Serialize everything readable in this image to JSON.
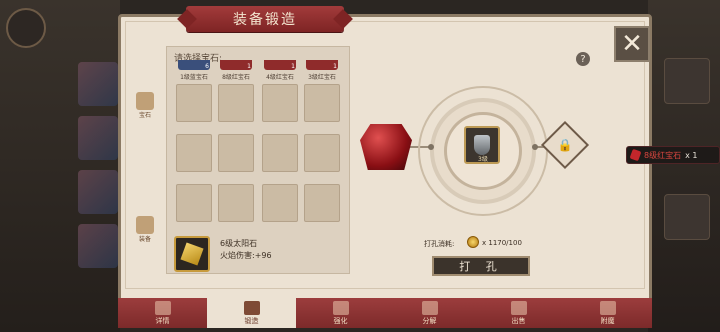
{
  "title": "装备锻造",
  "close_label": "✕",
  "help_label": "?",
  "side_tabs": [
    {
      "label": "宝石"
    },
    {
      "label": "装备"
    }
  ],
  "gem_picker": {
    "label": "请选择宝石:",
    "top_gems": [
      {
        "name": "1级蓝宝石",
        "count": "6"
      },
      {
        "name": "8级红宝石",
        "count": "1"
      },
      {
        "name": "4级红宝石",
        "count": "1"
      },
      {
        "name": "3级红宝石",
        "count": "1"
      }
    ]
  },
  "selected_gem": {
    "name": "6级太阳石",
    "effect": "火焰伤害:+96"
  },
  "equip_level": "3级",
  "reward": {
    "name": "8级红宝石",
    "count": "x 1"
  },
  "cost": {
    "label": "打孔消耗:",
    "value": "x 1170/100"
  },
  "punch_button": "打  孔",
  "bottom_tabs": [
    {
      "label": "详情",
      "active": false
    },
    {
      "label": "锻造",
      "active": true
    },
    {
      "label": "强化",
      "active": false
    },
    {
      "label": "分解",
      "active": false
    },
    {
      "label": "出售",
      "active": false
    },
    {
      "label": "附魔",
      "active": false
    }
  ]
}
